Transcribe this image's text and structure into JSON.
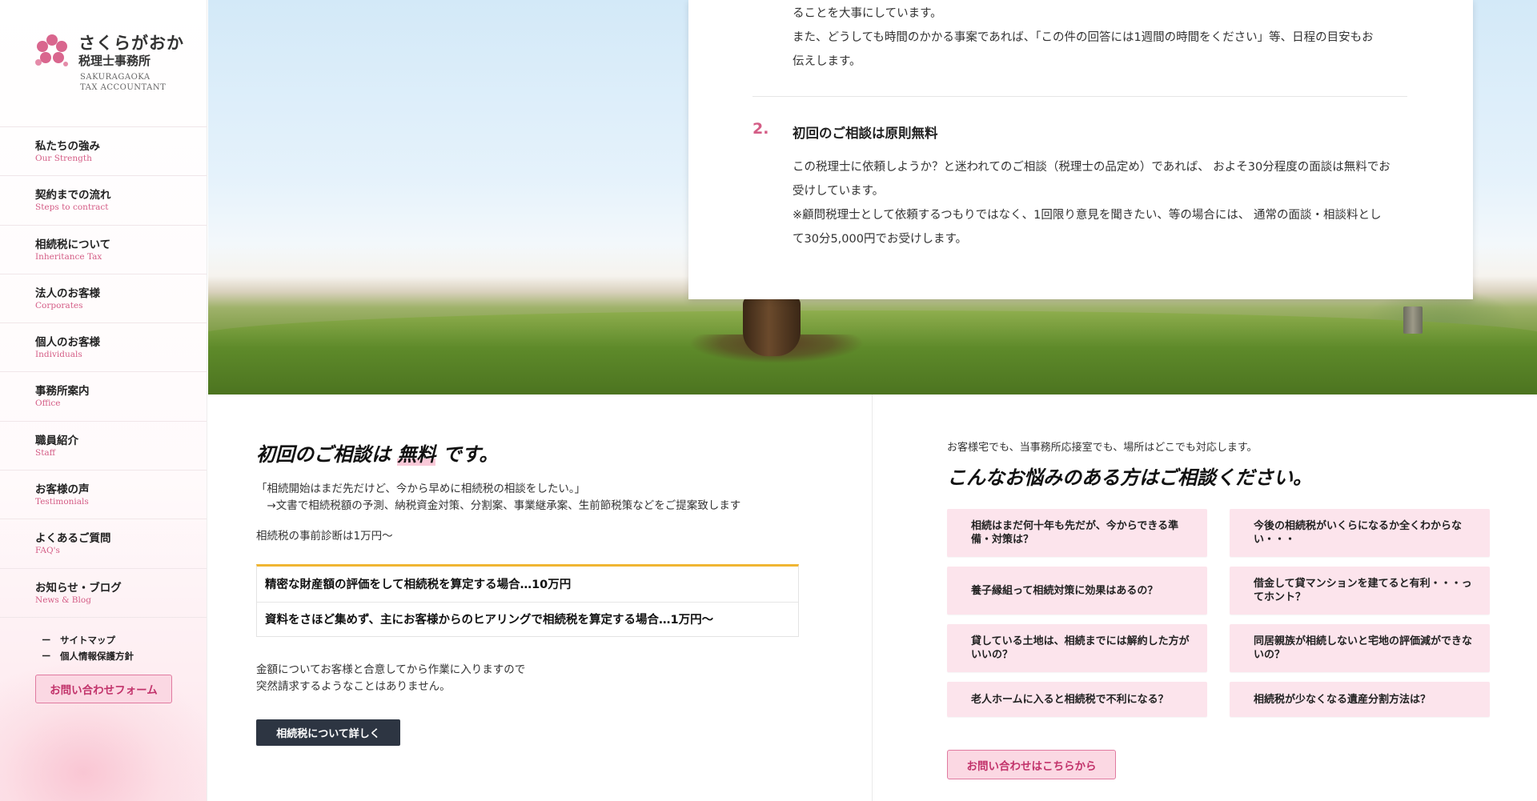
{
  "brand": {
    "name_line1": "さくらがおか",
    "name_line2": "税理士事務所",
    "name_en": "SAKURAGAOKA\nTAX ACCOUNTANT"
  },
  "nav": [
    {
      "ja": "私たちの強み",
      "en": "Our Strength"
    },
    {
      "ja": "契約までの流れ",
      "en": "Steps to contract"
    },
    {
      "ja": "相続税について",
      "en": "Inheritance Tax"
    },
    {
      "ja": "法人のお客様",
      "en": "Corporates"
    },
    {
      "ja": "個人のお客様",
      "en": "Individuals"
    },
    {
      "ja": "事務所案内",
      "en": "Office"
    },
    {
      "ja": "職員紹介",
      "en": "Staff"
    },
    {
      "ja": "お客様の声",
      "en": "Testimonials"
    },
    {
      "ja": "よくあるご質問",
      "en": "FAQ's"
    },
    {
      "ja": "お知らせ・ブログ",
      "en": "News & Blog"
    }
  ],
  "sub_links": [
    "ー　サイトマップ",
    "ー　個人情報保護方針"
  ],
  "sidebar_contact": "お問い合わせフォーム",
  "card": {
    "p1_line1": "ることを大事にしています。",
    "p1_line2": "また、どうしても時間のかかる事案であれば、「この件の回答には1週間の時間をください」等、日程の目安もお",
    "p1_line3": "伝えします。",
    "num": "2.",
    "title": "初回のご相談は原則無料",
    "p2_line1": "この税理士に依頼しようか？と迷われてのご相談（税理士の品定め）であれば、 およそ30分程度の面談は無料でお",
    "p2_line2": "受けしています。",
    "p2_line3": "※顧問税理士として依頼するつもりではなく、1回限り意見を聞きたい、等の場合には、 通常の面談・相談料とし",
    "p2_line4": "て30分5,000円でお受けします。"
  },
  "free": {
    "heading_pre": "初回のご相談は ",
    "heading_hl": "無料",
    "heading_post": " です。",
    "lead": "「相続開始はまだ先だけど、今から早めに相続税の相談をしたい。」\n　→文書で相続税額の予測、納税資金対策、分割案、事業継承案、生前節税策などをご提案致します",
    "diagnosis": "相続税の事前診断は1万円〜",
    "prices": [
      "精密な財産額の評価をして相続税を算定する場合…10万円",
      "資料をさほど集めず、主にお客様からのヒアリングで相続税を算定する場合…1万円〜"
    ],
    "note": "金額についてお客様と合意してから作業に入りますので\n突然請求するようなことはありません。",
    "detail_button": "相続税について詳しく"
  },
  "worries": {
    "sub": "お客様宅でも、当事務所応接室でも、場所はどこでも対応します。",
    "heading": "こんなお悩みのある方はご相談ください。",
    "items": [
      "相続はまだ何十年も先だが、今からできる準備・対策は？",
      "今後の相続税がいくらになるか全くわからない・・・",
      "養子縁組って相続対策に効果はあるの？",
      "借金して貸マンションを建てると有利・・・ってホント？",
      "貸している土地は、相続までには解約した方がいいの？",
      "同居親族が相続しないと宅地の評価減ができないの？",
      "老人ホームに入ると相続税で不利になる？",
      "相続税が少なくなる遺産分割方法は？"
    ],
    "contact_button": "お問い合わせはこちらから"
  },
  "colors": {
    "accent_pink": "#d45d86",
    "button_pink_bg": "#fbd8e3",
    "table_top_border": "#f0b532",
    "dark_button": "#2d3542"
  }
}
